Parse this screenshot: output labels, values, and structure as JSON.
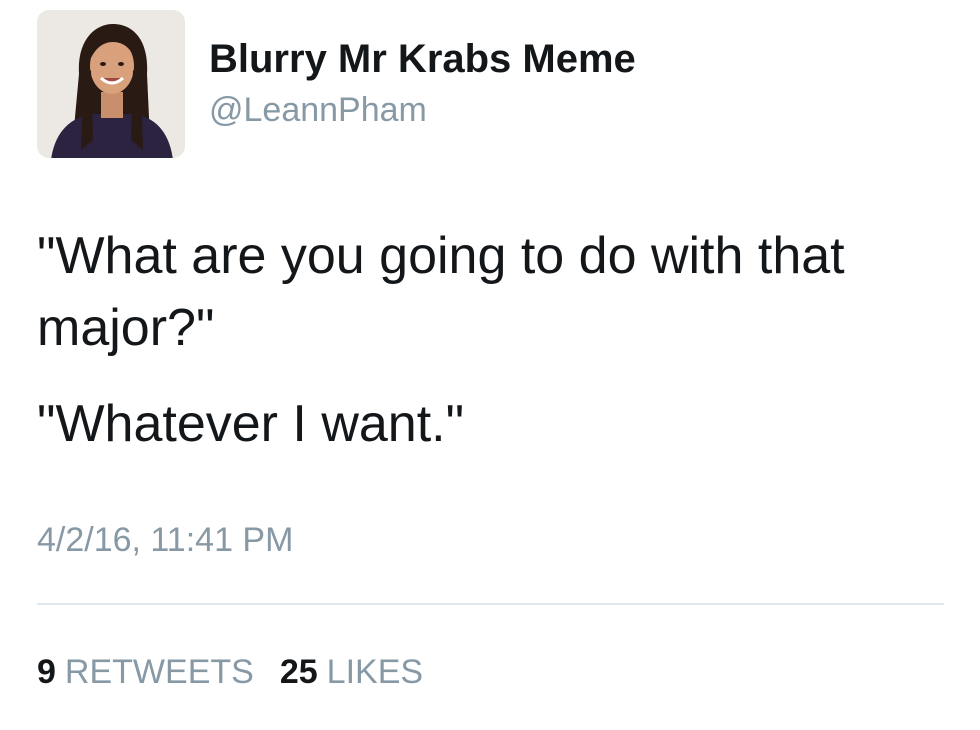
{
  "user": {
    "display_name": "Blurry Mr Krabs Meme",
    "handle": "@LeannPham",
    "avatar_icon": "profile-photo"
  },
  "tweet": {
    "paragraphs": [
      "\"What are you going to do with that major?\"",
      "\"Whatever I want.\""
    ],
    "timestamp": "4/2/16, 11:41 PM"
  },
  "stats": {
    "retweets_count": "9",
    "retweets_label": "RETWEETS",
    "likes_count": "25",
    "likes_label": "LIKES"
  },
  "colors": {
    "text_primary": "#14171a",
    "text_secondary": "#8899a6",
    "divider": "#e1e8ed"
  }
}
